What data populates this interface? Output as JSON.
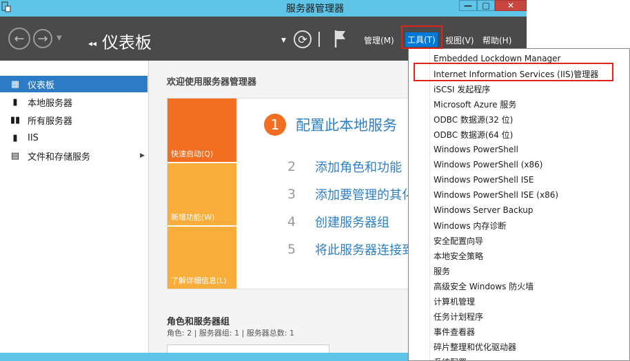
{
  "window": {
    "title": "服务器管理器",
    "min_glyph": "—",
    "max_glyph": "□",
    "close_glyph": "✕"
  },
  "toolbar": {
    "breadcrumb_arrows": "◂◂",
    "breadcrumb": "仪表板",
    "menus": {
      "manage": "管理(M)",
      "tools": "工具(T)",
      "view": "视图(V)",
      "help": "帮助(H)"
    }
  },
  "sidebar": {
    "items": [
      {
        "label": "仪表板",
        "icon": "dashboard-icon",
        "active": true
      },
      {
        "label": "本地服务器",
        "icon": "server-icon"
      },
      {
        "label": "所有服务器",
        "icon": "servers-icon"
      },
      {
        "label": "IIS",
        "icon": "iis-icon"
      },
      {
        "label": "文件和存储服务",
        "icon": "file-storage-icon",
        "expandable": true
      }
    ]
  },
  "main": {
    "welcome": "欢迎使用服务器管理器",
    "tiles": [
      {
        "label": "快速启动(Q)"
      },
      {
        "label": "新增功能(W)"
      },
      {
        "label": "了解详细信息(L)"
      }
    ],
    "steps": [
      {
        "num": "1",
        "text": "配置此本地服务"
      },
      {
        "num": "2",
        "text": "添加角色和功能"
      },
      {
        "num": "3",
        "text": "添加要管理的其化"
      },
      {
        "num": "4",
        "text": "创建服务器组"
      },
      {
        "num": "5",
        "text": "将此服务器连接到"
      }
    ],
    "roles_title": "角色和服务器组",
    "roles_summary": "角色: 2 | 服务器组: 1 | 服务器总数: 1"
  },
  "tools_menu": {
    "items": [
      "Embedded Lockdown Manager",
      "Internet Information Services (IIS)管理器",
      "iSCSI 发起程序",
      "Microsoft Azure 服务",
      "ODBC 数据源(32 位)",
      "ODBC 数据源(64 位)",
      "Windows PowerShell",
      "Windows PowerShell (x86)",
      "Windows PowerShell ISE",
      "Windows PowerShell ISE (x86)",
      "Windows Server Backup",
      "Windows 内存诊断",
      "安全配置向导",
      "本地安全策略",
      "服务",
      "高级安全 Windows 防火墙",
      "计算机管理",
      "任务计划程序",
      "事件查看器",
      "碎片整理和优化驱动器",
      "系统配置"
    ]
  },
  "colors": {
    "accent": "#2b7bc6",
    "highlight_box": "#e0231d",
    "tile_primary": "#f26f21",
    "tile_secondary": "#fbad3c",
    "link": "#2f7fc3"
  }
}
